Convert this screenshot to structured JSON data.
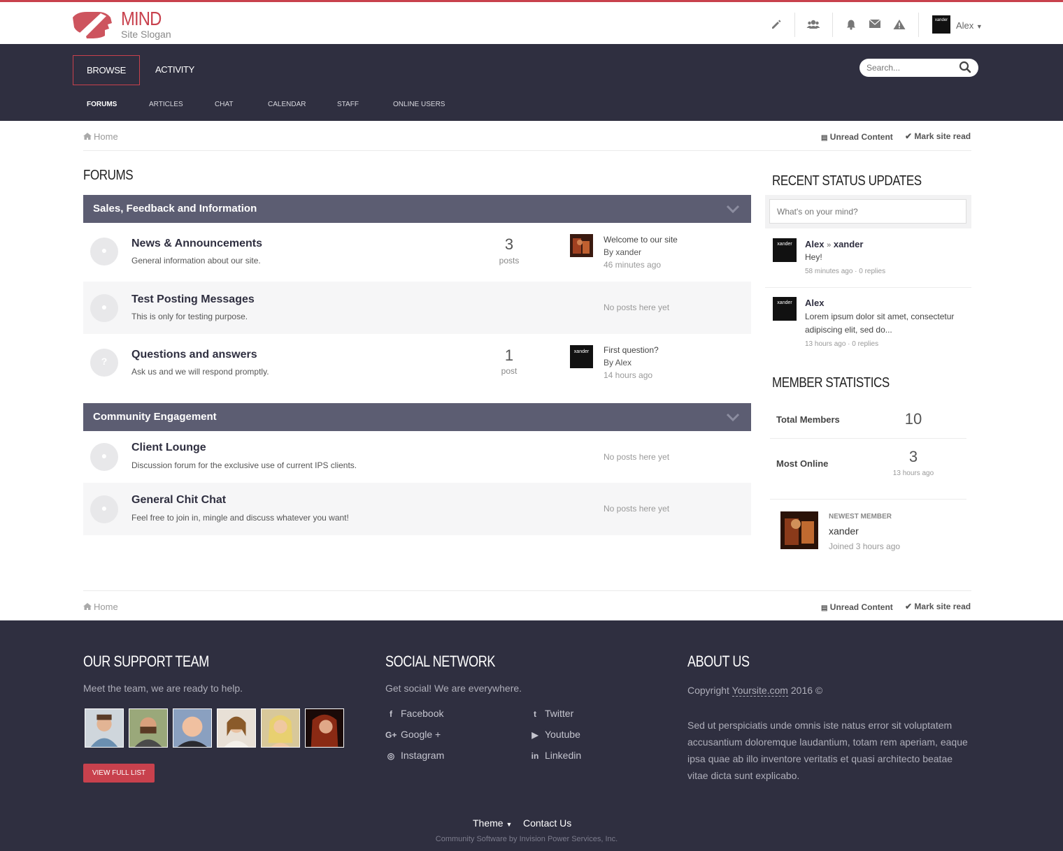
{
  "header": {
    "brand": "MIND",
    "slogan": "Site Slogan",
    "user": "Alex",
    "user_avatar_text": "xander"
  },
  "nav": {
    "tabs": [
      {
        "label": "BROWSE"
      },
      {
        "label": "ACTIVITY"
      }
    ],
    "search_placeholder": "Search...",
    "subnav": [
      "FORUMS",
      "ARTICLES",
      "CHAT",
      "CALENDAR",
      "STAFF",
      "ONLINE USERS"
    ]
  },
  "breadcrumb": {
    "home": "Home",
    "unread": "Unread Content",
    "mark_read": "Mark site read"
  },
  "forums": {
    "title": "FORUMS",
    "categories": [
      {
        "title": "Sales, Feedback and Information",
        "forums": [
          {
            "title": "News & Announcements",
            "desc": "General information about our site.",
            "count": "3",
            "count_label": "posts",
            "last_title": "Welcome to our site",
            "last_by": "By xander",
            "last_time": "46 minutes ago"
          },
          {
            "title": "Test Posting Messages",
            "desc": "This is only for testing purpose.",
            "none": "No posts here yet"
          },
          {
            "title": "Questions and answers",
            "desc": "Ask us and we will respond promptly.",
            "count": "1",
            "count_label": "post",
            "last_title": "First question?",
            "last_by": "By Alex",
            "last_time": "14 hours ago",
            "icon": "?"
          }
        ]
      },
      {
        "title": "Community Engagement",
        "forums": [
          {
            "title": "Client Lounge",
            "desc": "Discussion forum for the exclusive use of current IPS clients.",
            "none": "No posts here yet"
          },
          {
            "title": "General Chit Chat",
            "desc": "Feel free to join in, mingle and discuss whatever you want!",
            "none": "No posts here yet"
          }
        ]
      }
    ]
  },
  "sidebar": {
    "status_title": "RECENT STATUS UPDATES",
    "status_placeholder": "What's on your mind?",
    "updates": [
      {
        "from": "Alex",
        "sep": "»",
        "to": "xander",
        "text": "Hey!",
        "meta": "58 minutes ago · 0 replies",
        "avatar_text": "xander"
      },
      {
        "from": "Alex",
        "text": "Lorem ipsum dolor sit amet, consectetur adipiscing elit, sed do...",
        "meta": "13 hours ago · 0 replies",
        "avatar_text": "xander"
      }
    ],
    "stats_title": "MEMBER STATISTICS",
    "total_label": "Total Members",
    "total_value": "10",
    "online_label": "Most Online",
    "online_value": "3",
    "online_time": "13 hours ago",
    "newest_label": "NEWEST MEMBER",
    "newest_name": "xander",
    "newest_joined": "Joined 3 hours ago"
  },
  "footer": {
    "support_title": "OUR SUPPORT TEAM",
    "support_text": "Meet the team, we are ready to help.",
    "view_btn": "VIEW FULL LIST",
    "social_title": "SOCIAL NETWORK",
    "social_text": "Get social! We are everywhere.",
    "social": [
      {
        "label": "Facebook",
        "icon": "f"
      },
      {
        "label": "Twitter",
        "icon": "t"
      },
      {
        "label": "Google +",
        "icon": "G+"
      },
      {
        "label": "Youtube",
        "icon": "▶"
      },
      {
        "label": "Instagram",
        "icon": "◎"
      },
      {
        "label": "Linkedin",
        "icon": "in"
      }
    ],
    "about_title": "ABOUT US",
    "copyright_prefix": "Copyright ",
    "copyright_link": "Yoursite.com",
    "copyright_suffix": " 2016 ©",
    "about_text": "Sed ut perspiciatis unde omnis iste natus error sit voluptatem accusantium doloremque laudantium, totam rem aperiam, eaque ipsa quae ab illo inventore veritatis et quasi architecto beatae vitae dicta sunt explicabo.",
    "theme": "Theme",
    "contact": "Contact Us",
    "powered": "Community Software by Invision Power Services, Inc."
  },
  "colors": {
    "accent": "#c8414d",
    "nav_bg": "#2f2f40",
    "category_bar": "#5c5d72"
  }
}
